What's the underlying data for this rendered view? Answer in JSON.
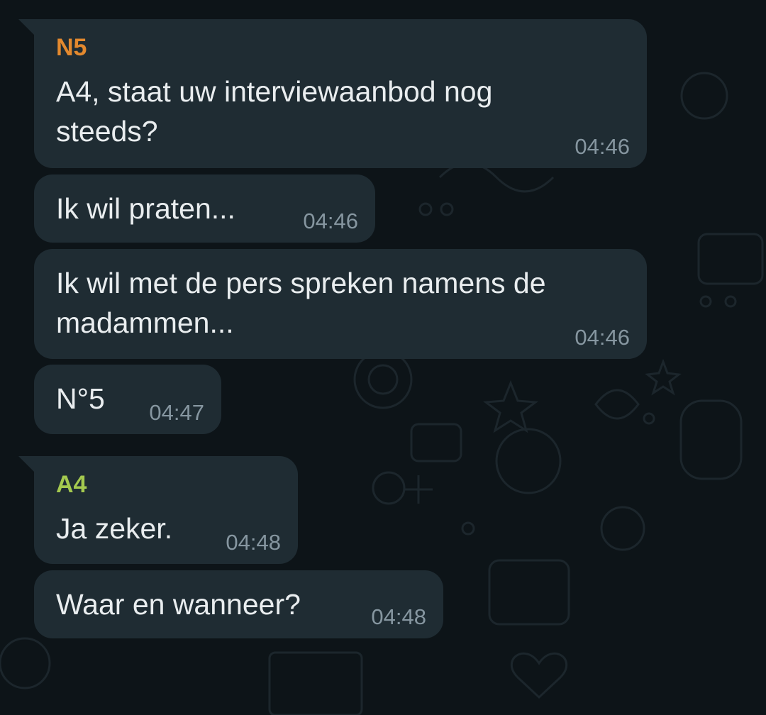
{
  "messages": [
    {
      "sender": "N5",
      "sender_color": "#e3892e",
      "lines": [
        "A4, staat uw interviewaanbod nog",
        "steeds?"
      ],
      "time": "04:46"
    },
    {
      "lines": [
        "Ik wil praten..."
      ],
      "time": "04:46"
    },
    {
      "lines": [
        "Ik wil met de pers spreken namens de",
        "madammen..."
      ],
      "time": "04:46"
    },
    {
      "lines": [
        "N°5"
      ],
      "time": "04:47"
    },
    {
      "sender": "A4",
      "sender_color": "#a4c94f",
      "lines": [
        "Ja zeker."
      ],
      "time": "04:48"
    },
    {
      "lines": [
        "Waar en wanneer?"
      ],
      "time": "04:48"
    }
  ]
}
